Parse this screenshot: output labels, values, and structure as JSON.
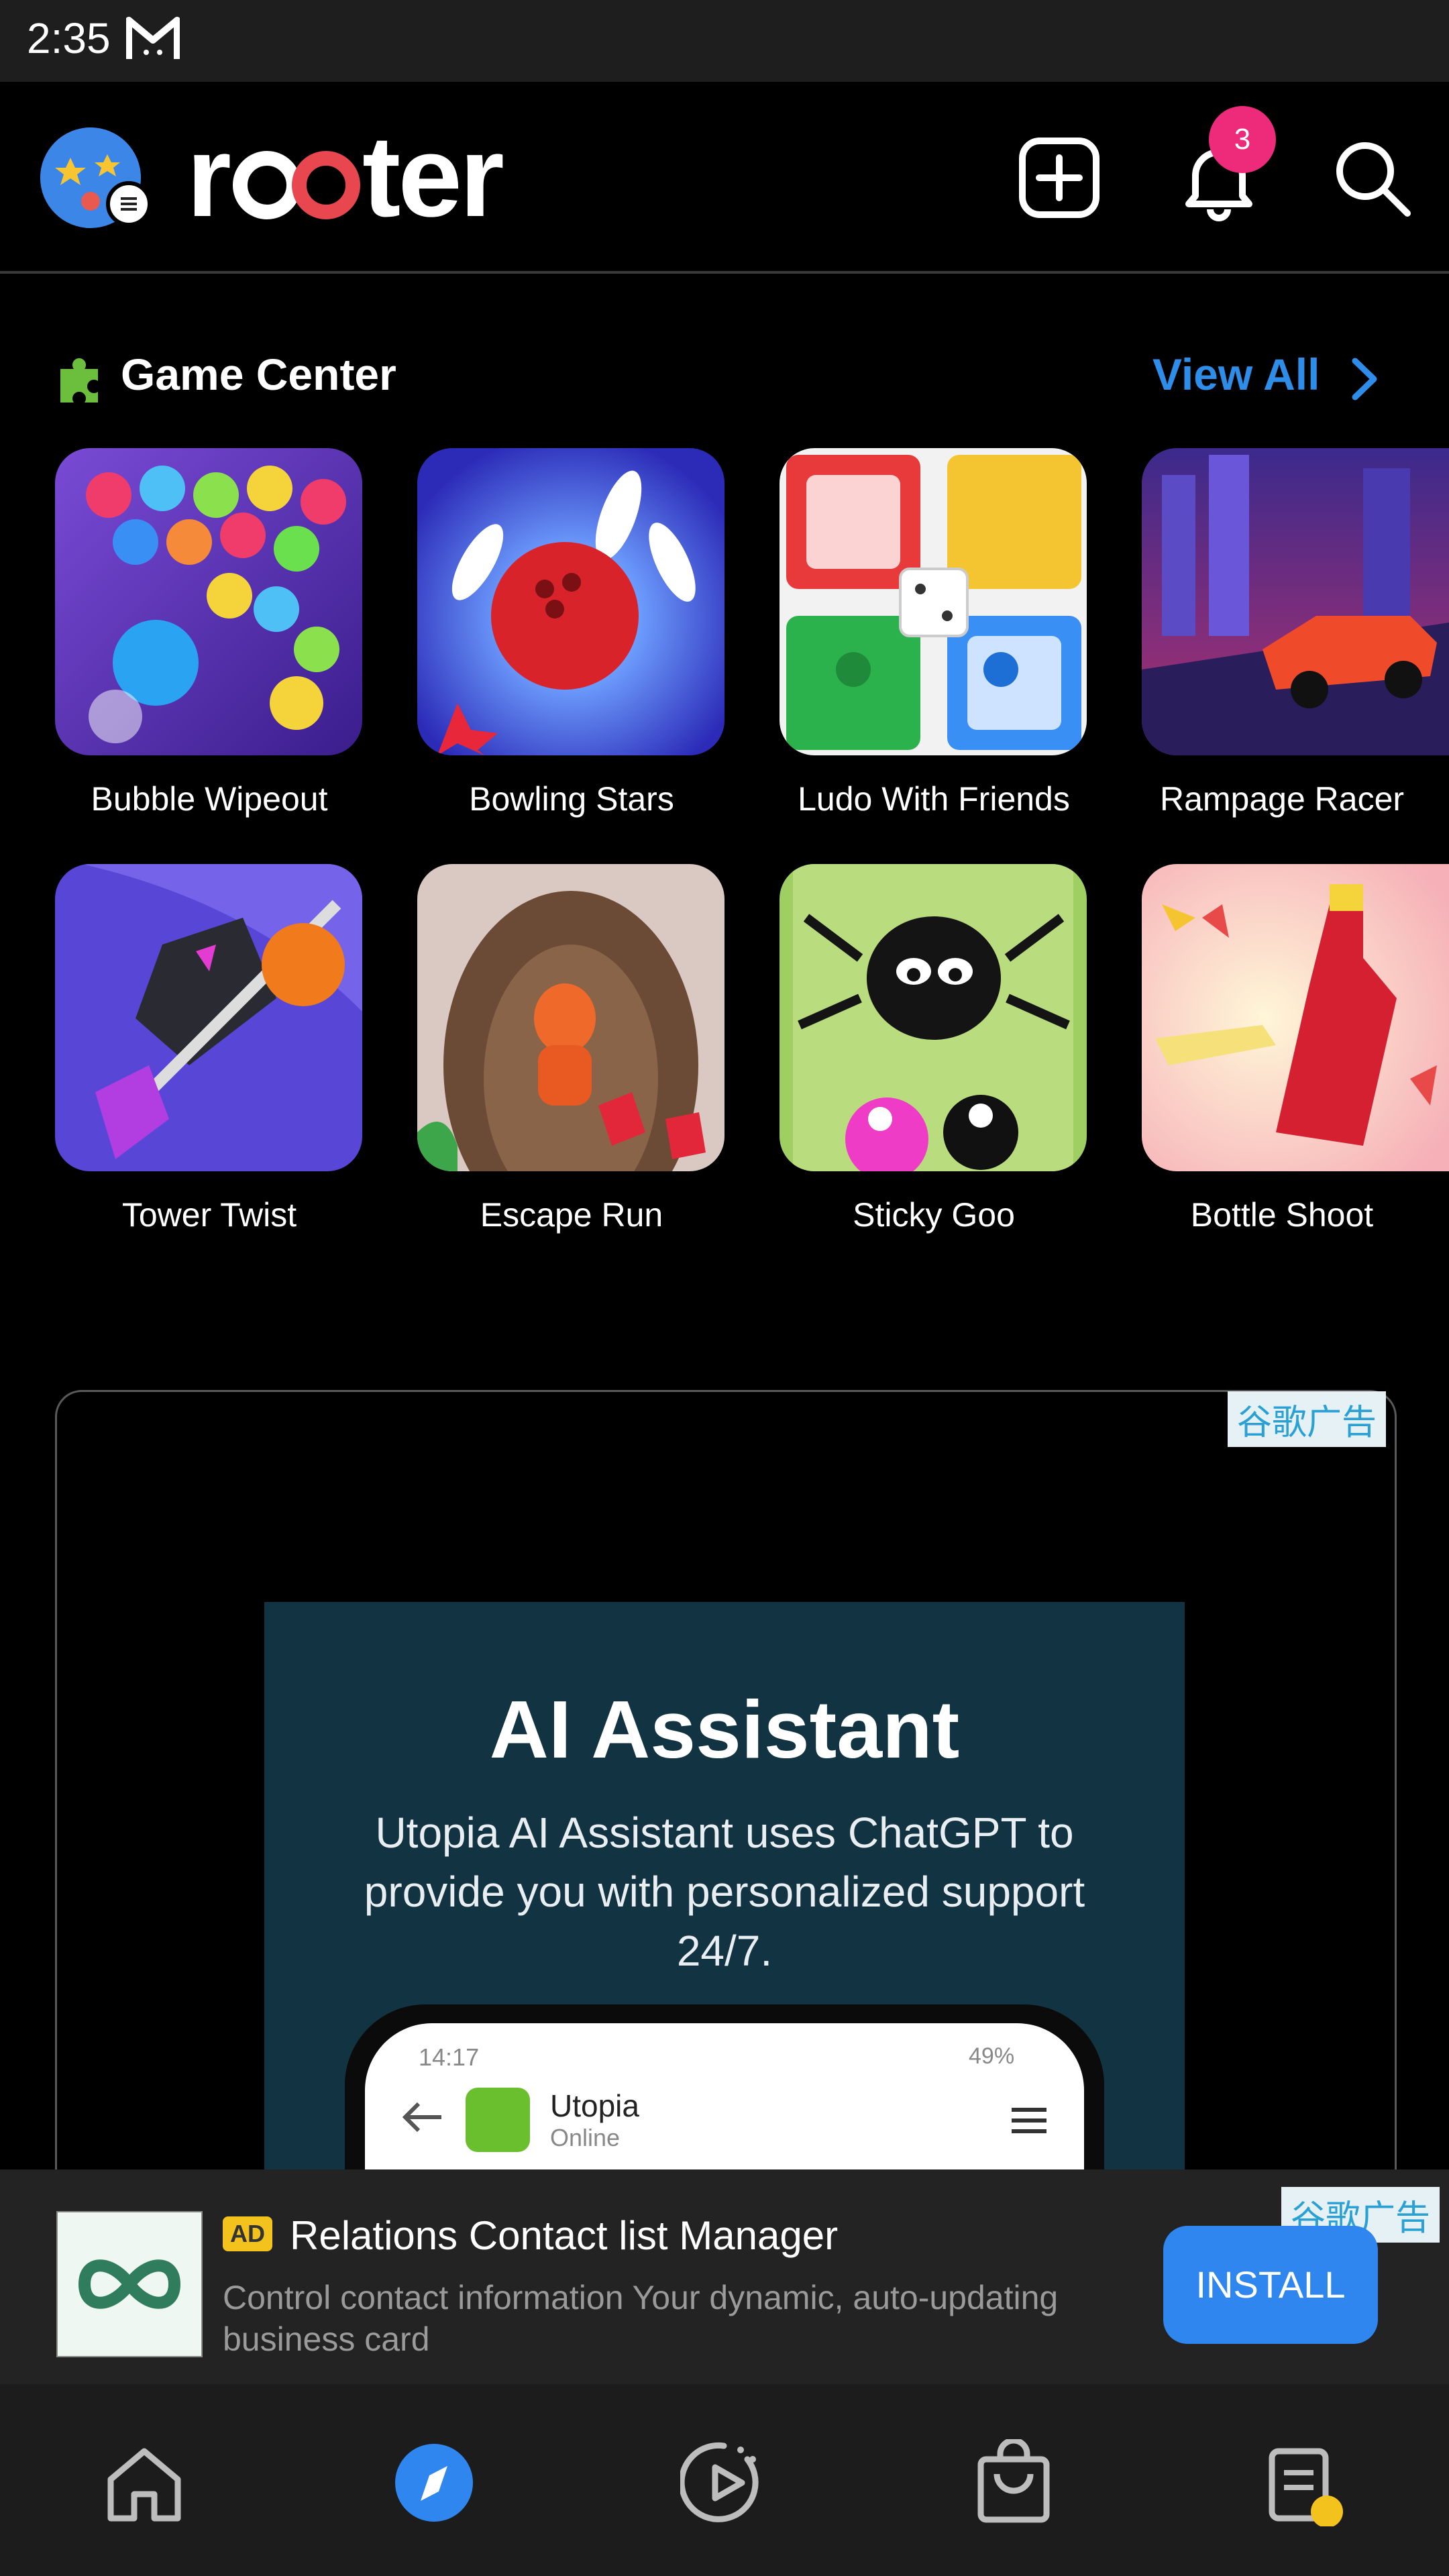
{
  "status_bar": {
    "time": "2:35"
  },
  "header": {
    "logo": "rooter",
    "notification_count": "3"
  },
  "game_center": {
    "title": "Game Center",
    "view_all_label": "View All",
    "games": [
      {
        "name": "Bubble Wipeout"
      },
      {
        "name": "Bowling Stars"
      },
      {
        "name": "Ludo With Friends"
      },
      {
        "name": "Rampage Racer"
      },
      {
        "name": "Tower Twist"
      },
      {
        "name": "Escape Run"
      },
      {
        "name": "Sticky Goo"
      },
      {
        "name": "Bottle Shoot"
      }
    ]
  },
  "ad_card": {
    "tag": "谷歌广告",
    "heading": "AI Assistant",
    "description": "Utopia AI Assistant uses ChatGPT to provide you with personalized support 24/7.",
    "phone": {
      "time": "14:17",
      "battery": "49%",
      "app_name": "Utopia",
      "app_status": "Online"
    }
  },
  "banner_ad": {
    "tag": "谷歌广告",
    "badge": "AD",
    "title": "Relations Contact list Manager",
    "description": "Control contact information Your dynamic, auto-updating business card",
    "install_label": "INSTALL"
  },
  "colors": {
    "accent_blue": "#2e8de8",
    "notification_pink": "#ee2a7b",
    "install_blue": "#2f86ee",
    "ad_bg": "#123341"
  },
  "icons": {
    "header": [
      "create-post-icon",
      "bell-icon",
      "search-icon"
    ],
    "bottom_nav": [
      "home-icon",
      "explore-icon",
      "videos-icon",
      "store-icon",
      "tasks-icon"
    ]
  }
}
